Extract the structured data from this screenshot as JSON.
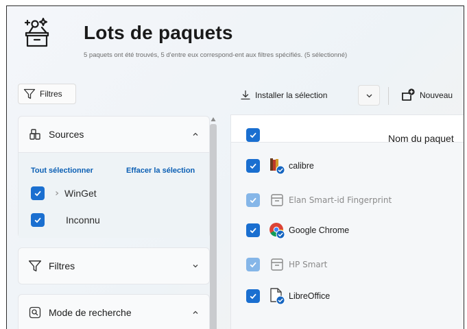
{
  "header": {
    "title": "Lots de paquets",
    "subtitle": "5 paquets ont été trouvés, 5 d'entre eux correspond-ent aux filtres spécifiés. (5 sélectionné)"
  },
  "left_toolbar": {
    "filter_label": "Filtres"
  },
  "toolbar": {
    "install_label": "Installer la sélection",
    "new_label": "Nouveau"
  },
  "sources": {
    "title": "Sources",
    "select_all": "Tout sélectionner",
    "clear_selection": "Effacer la sélection",
    "items": [
      {
        "label": "WinGet",
        "checked": true,
        "expandable": true
      },
      {
        "label": "Inconnu",
        "checked": true,
        "expandable": false
      }
    ]
  },
  "filters_section": {
    "title": "Filtres"
  },
  "search_mode_section": {
    "title": "Mode de recherche"
  },
  "table": {
    "column_name": "Nom du paquet",
    "header_checked": true,
    "rows": [
      {
        "name": "calibre",
        "icon": "calibre-icon",
        "checked": true,
        "enabled": true
      },
      {
        "name": "Elan Smart-id Fingerprint",
        "icon": "package-icon",
        "checked": true,
        "enabled": false
      },
      {
        "name": "Google Chrome",
        "icon": "chrome-icon",
        "checked": true,
        "enabled": true
      },
      {
        "name": "HP Smart",
        "icon": "package-icon",
        "checked": true,
        "enabled": false
      },
      {
        "name": "LibreOffice",
        "icon": "libreoffice-icon",
        "checked": true,
        "enabled": true
      }
    ]
  },
  "colors": {
    "accent": "#1a6fd0",
    "accent_disabled": "#85b6e8",
    "link": "#0b5fb4",
    "badge": "#1565c0"
  }
}
